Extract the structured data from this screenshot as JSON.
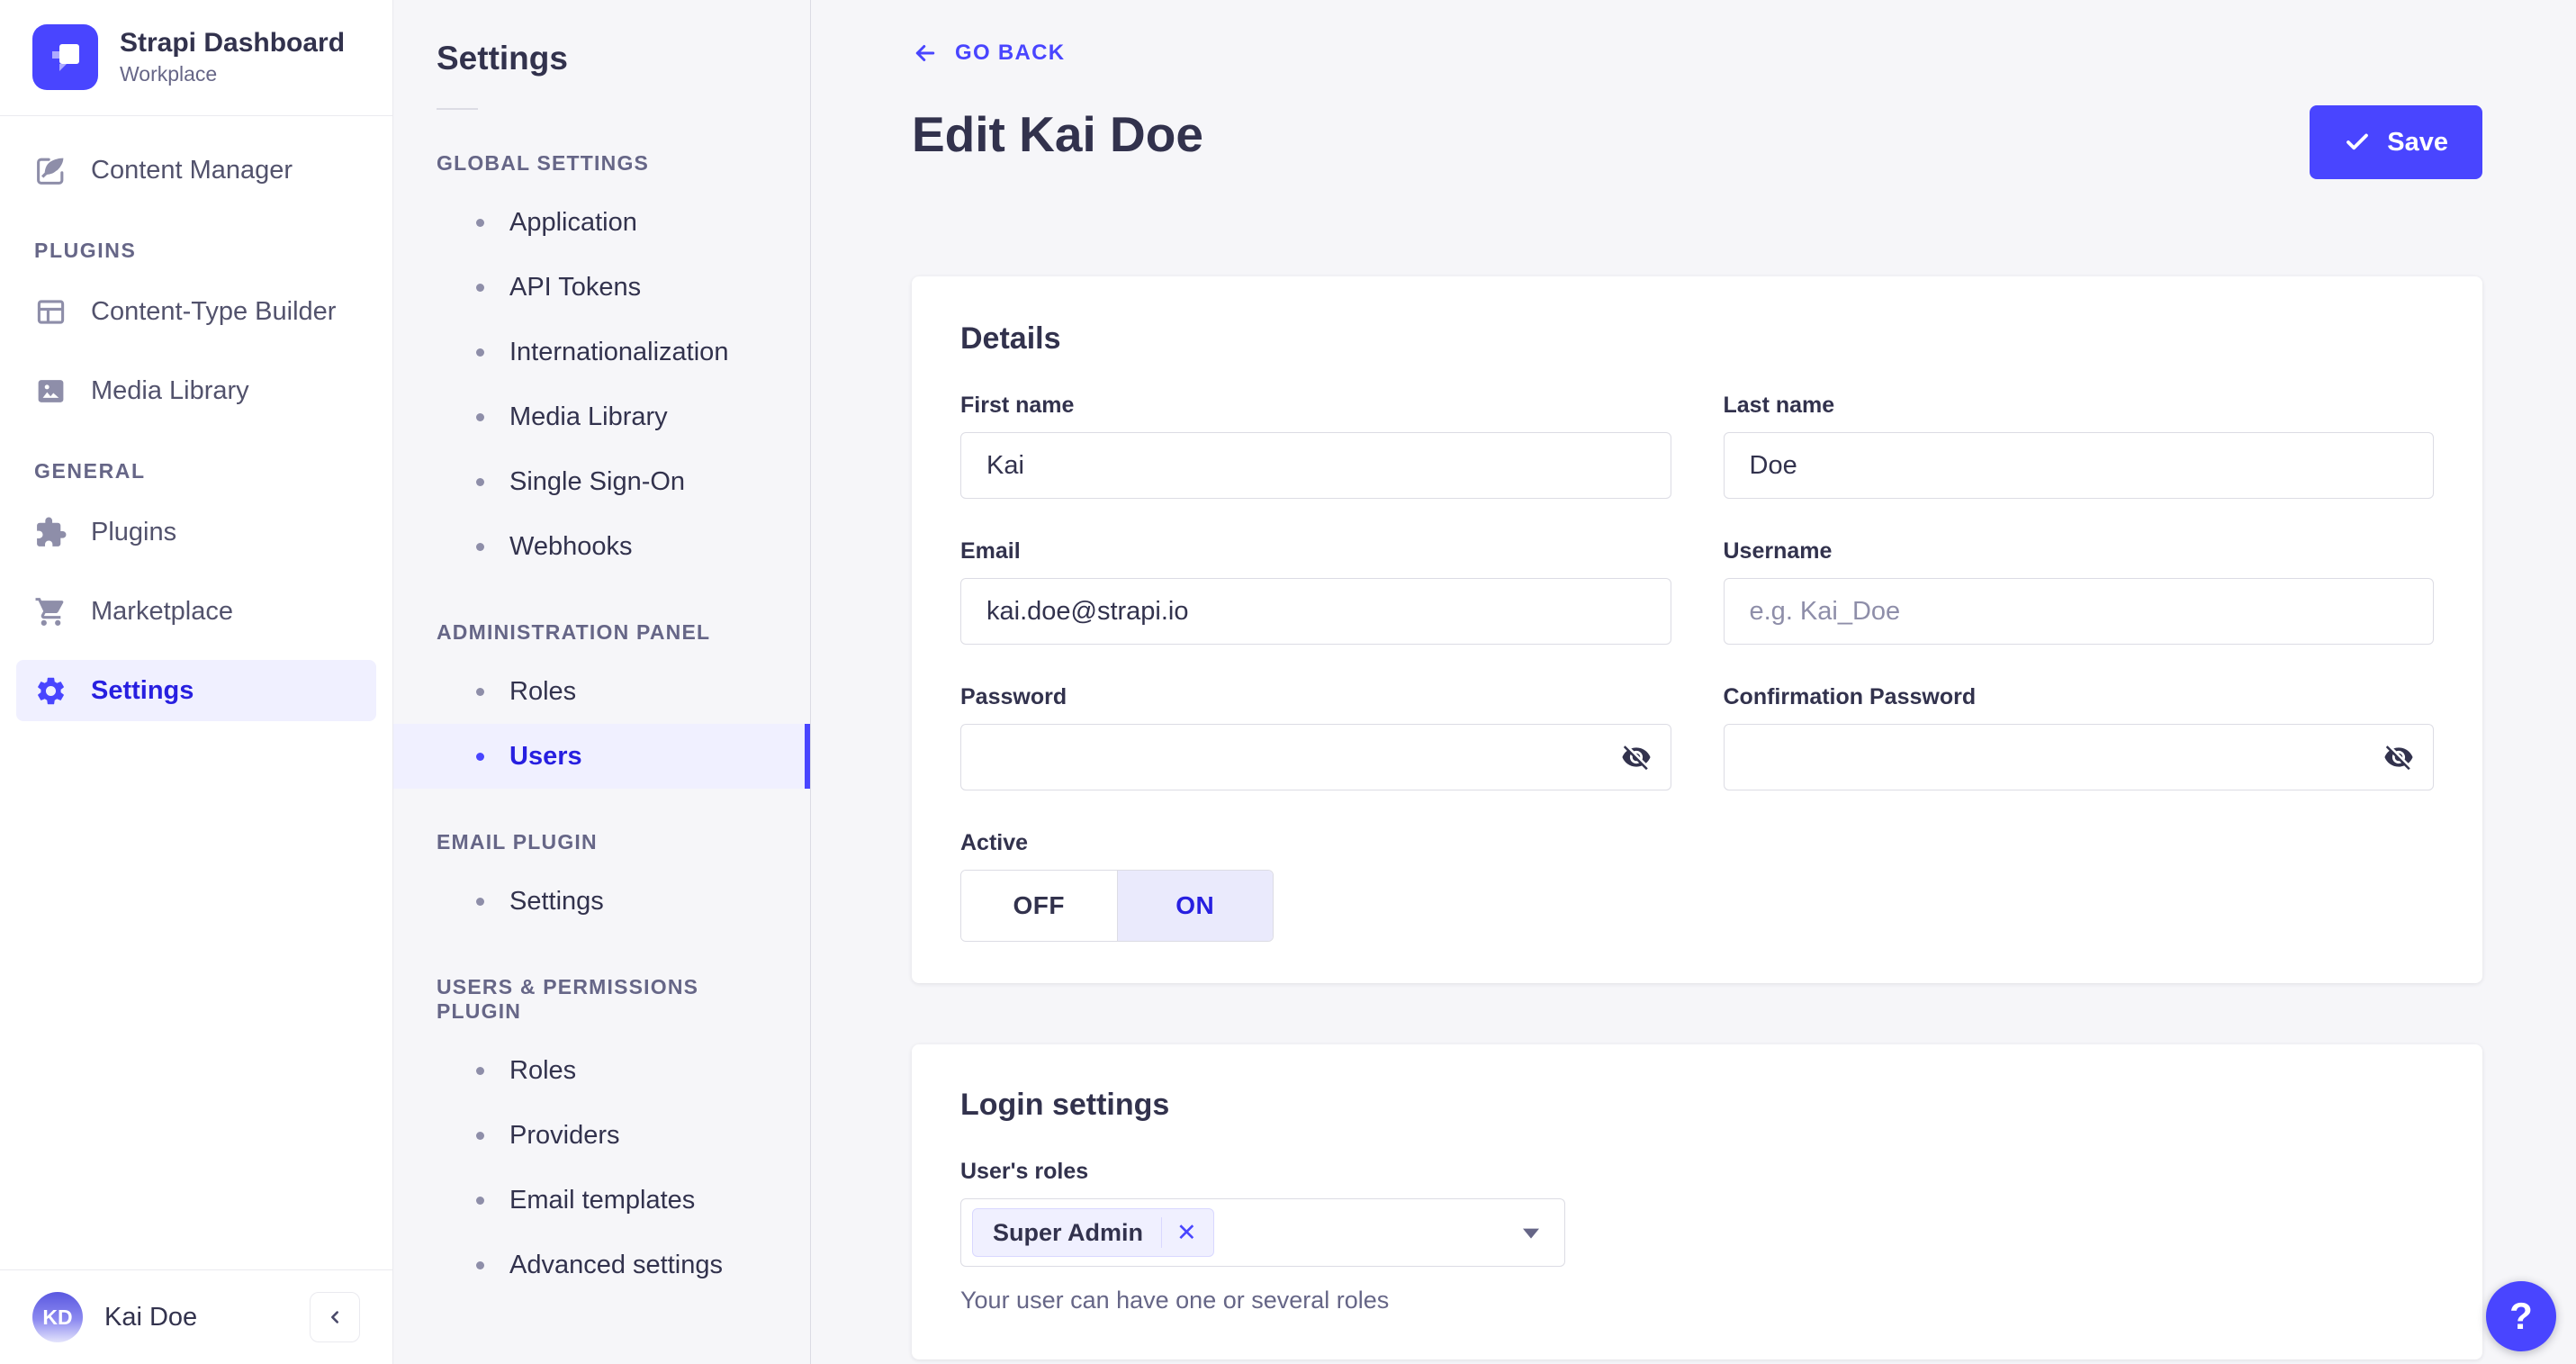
{
  "colors": {
    "accent": "#4945ff",
    "accent_dark": "#271fe0",
    "accent_bg": "#f0f0ff",
    "page_bg": "#f6f6f9",
    "text": "#32324d",
    "muted": "#666687",
    "border": "#dcdce4"
  },
  "brand": {
    "title": "Strapi Dashboard",
    "subtitle": "Workplace"
  },
  "sidebar": {
    "main_item": "Content Manager",
    "sections": [
      {
        "label": "PLUGINS",
        "items": [
          "Content-Type Builder",
          "Media Library"
        ]
      },
      {
        "label": "GENERAL",
        "items": [
          "Plugins",
          "Marketplace",
          "Settings"
        ]
      }
    ],
    "active_item": "Settings",
    "user": {
      "initials": "KD",
      "name": "Kai Doe"
    }
  },
  "subnav": {
    "title": "Settings",
    "sections": [
      {
        "label": "GLOBAL SETTINGS",
        "items": [
          "Application",
          "API Tokens",
          "Internationalization",
          "Media Library",
          "Single Sign-On",
          "Webhooks"
        ]
      },
      {
        "label": "ADMINISTRATION PANEL",
        "items": [
          "Roles",
          "Users"
        ],
        "active_item": "Users"
      },
      {
        "label": "EMAIL PLUGIN",
        "items": [
          "Settings"
        ]
      },
      {
        "label": "USERS & PERMISSIONS PLUGIN",
        "items": [
          "Roles",
          "Providers",
          "Email templates",
          "Advanced settings"
        ]
      }
    ]
  },
  "header": {
    "back": "GO BACK",
    "title": "Edit Kai Doe",
    "save": "Save"
  },
  "details": {
    "title": "Details",
    "fields": {
      "first_name": {
        "label": "First name",
        "value": "Kai"
      },
      "last_name": {
        "label": "Last name",
        "value": "Doe"
      },
      "email": {
        "label": "Email",
        "value": "kai.doe@strapi.io"
      },
      "username": {
        "label": "Username",
        "placeholder": "e.g. Kai_Doe",
        "value": ""
      },
      "password": {
        "label": "Password",
        "value": ""
      },
      "confirmation_password": {
        "label": "Confirmation Password",
        "value": ""
      },
      "active": {
        "label": "Active",
        "off": "OFF",
        "on": "ON",
        "value": "ON"
      }
    }
  },
  "login_settings": {
    "title": "Login settings",
    "roles_label": "User's roles",
    "selected_roles": [
      "Super Admin"
    ],
    "helper": "Your user can have one or several roles"
  },
  "icons": {
    "remove_role": "✕",
    "help": "?"
  }
}
